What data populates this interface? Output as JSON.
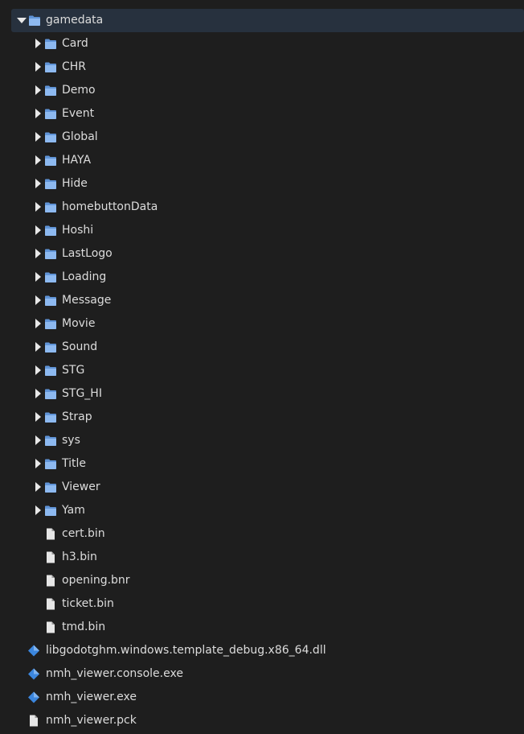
{
  "tree": {
    "root": {
      "label": "gamedata",
      "icon": "folder-icon",
      "expanded": true
    },
    "folders": [
      "Card",
      "CHR",
      "Demo",
      "Event",
      "Global",
      "HAYA",
      "Hide",
      "homebuttonData",
      "Hoshi",
      "LastLogo",
      "Loading",
      "Message",
      "Movie",
      "Sound",
      "STG",
      "STG_HI",
      "Strap",
      "sys",
      "Title",
      "Viewer",
      "Yam"
    ],
    "child_files": [
      "cert.bin",
      "h3.bin",
      "opening.bnr",
      "ticket.bin",
      "tmd.bin"
    ],
    "top_files": [
      {
        "label": "libgodotghm.windows.template_debug.x86_64.dll",
        "icon": "diamond-file-icon"
      },
      {
        "label": "nmh_viewer.console.exe",
        "icon": "diamond-file-icon"
      },
      {
        "label": "nmh_viewer.exe",
        "icon": "diamond-file-icon"
      },
      {
        "label": "nmh_viewer.pck",
        "icon": "file-icon"
      }
    ]
  },
  "colors": {
    "background": "#1e1e1e",
    "selection": "#27313e",
    "folder": "#8db9f0",
    "folder_dark": "#5f93d6",
    "file": "#e6e6e6",
    "diamond": "#3b86de",
    "text": "#dcdcdc"
  }
}
